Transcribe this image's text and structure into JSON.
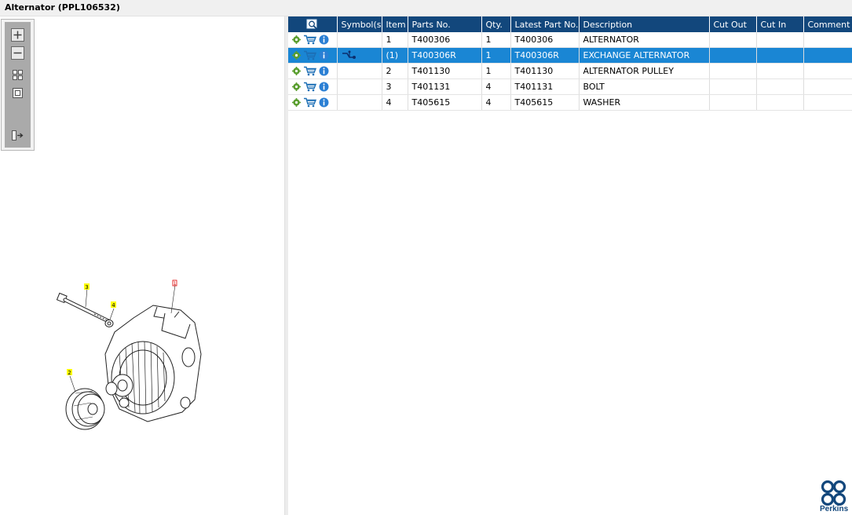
{
  "window": {
    "title": "Alternator (PPL106532)"
  },
  "viewer_toolbar": {
    "buttons": [
      {
        "name": "zoom-in",
        "icon": "zoom-in-icon"
      },
      {
        "name": "zoom-out",
        "icon": "zoom-out-icon"
      },
      {
        "name": "fit-all",
        "icon": "fit-all-icon"
      },
      {
        "name": "fit-page",
        "icon": "fit-page-icon"
      },
      {
        "name": "toggle-list",
        "icon": "toggle-list-icon"
      }
    ]
  },
  "diagram": {
    "callouts": [
      "3",
      "4",
      "2",
      "1"
    ]
  },
  "table": {
    "columns": [
      "",
      "Symbol(s)",
      "Item",
      "Parts No.",
      "Qty.",
      "Latest Part No.",
      "Description",
      "Cut Out",
      "Cut In",
      "Comment"
    ],
    "rows": [
      {
        "item": "1",
        "part_no": "T400306",
        "qty": "1",
        "latest": "T400306",
        "description": "ALTERNATOR",
        "cut_out": "",
        "cut_in": "",
        "comment": "",
        "selected": false,
        "has_symbol": false
      },
      {
        "item": "(1)",
        "part_no": "T400306R",
        "qty": "1",
        "latest": "T400306R",
        "description": "EXCHANGE ALTERNATOR",
        "cut_out": "",
        "cut_in": "",
        "comment": "",
        "selected": true,
        "has_symbol": true
      },
      {
        "item": "2",
        "part_no": "T401130",
        "qty": "1",
        "latest": "T401130",
        "description": "ALTERNATOR PULLEY",
        "cut_out": "",
        "cut_in": "",
        "comment": "",
        "selected": false,
        "has_symbol": false
      },
      {
        "item": "3",
        "part_no": "T401131",
        "qty": "4",
        "latest": "T401131",
        "description": "BOLT",
        "cut_out": "",
        "cut_in": "",
        "comment": "",
        "selected": false,
        "has_symbol": false
      },
      {
        "item": "4",
        "part_no": "T405615",
        "qty": "4",
        "latest": "T405615",
        "description": "WASHER",
        "cut_out": "",
        "cut_in": "",
        "comment": "",
        "selected": false,
        "has_symbol": false
      }
    ]
  },
  "brand": {
    "name": "Perkins",
    "color": "#12477c"
  },
  "colors": {
    "header": "#12477c",
    "selected_row": "#1a86d4",
    "gear": "#5a9e2f",
    "cart": "#1c6fb5",
    "info": "#2a7fd4"
  }
}
